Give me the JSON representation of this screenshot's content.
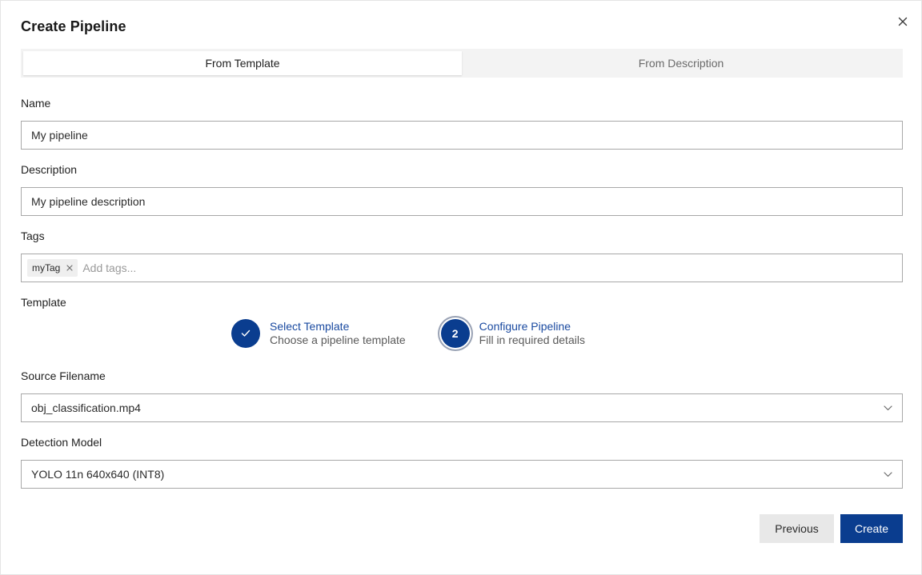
{
  "dialog": {
    "title": "Create Pipeline",
    "close_icon": "close-icon"
  },
  "tabs": [
    {
      "label": "From Template",
      "active": true
    },
    {
      "label": "From Description",
      "active": false
    }
  ],
  "form": {
    "name": {
      "label": "Name",
      "value": "My pipeline"
    },
    "description": {
      "label": "Description",
      "value": "My pipeline description"
    },
    "tags": {
      "label": "Tags",
      "chips": [
        "myTag"
      ],
      "placeholder": "Add tags..."
    },
    "template": {
      "label": "Template"
    },
    "source_filename": {
      "label": "Source Filename",
      "value": "obj_classification.mp4"
    },
    "detection_model": {
      "label": "Detection Model",
      "value": "YOLO 11n 640x640 (INT8)"
    }
  },
  "stepper": {
    "steps": [
      {
        "title": "Select Template",
        "subtitle": "Choose a pipeline template",
        "state": "completed",
        "icon": "check-icon"
      },
      {
        "title": "Configure Pipeline",
        "subtitle": "Fill in required details",
        "state": "current",
        "number": "2"
      }
    ]
  },
  "buttons": {
    "previous": "Previous",
    "create": "Create"
  },
  "colors": {
    "primary": "#0a3d8f",
    "step_title": "#1a4aa0",
    "secondary_button": "#e8e8e8",
    "tab_bar": "#f3f3f3"
  }
}
